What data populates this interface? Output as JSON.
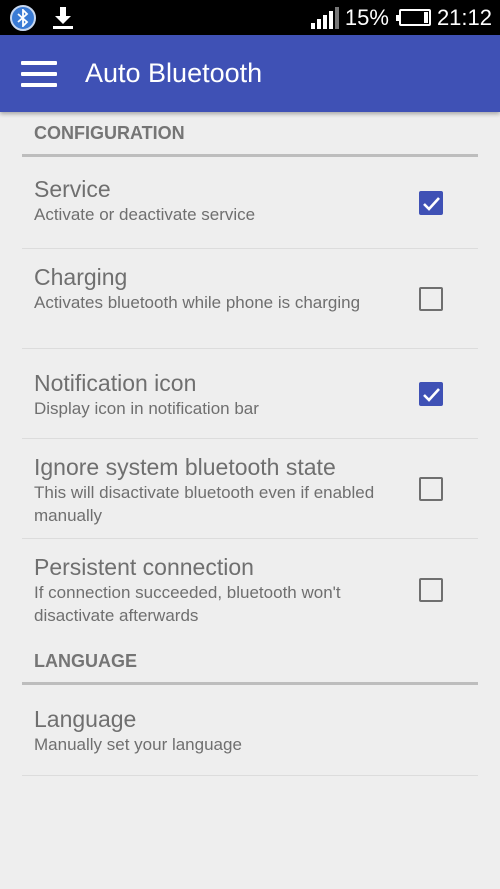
{
  "status_bar": {
    "battery": "15%",
    "battery_level": 0.15,
    "time": "21:12",
    "icons": [
      "bluetooth-icon",
      "download-icon",
      "signal-icon",
      "battery-icon"
    ]
  },
  "toolbar": {
    "title": "Auto Bluetooth",
    "color": "#3f51b5"
  },
  "sections": {
    "configuration": {
      "header": "CONFIGURATION",
      "items": [
        {
          "title": "Service",
          "summary": "Activate or deactivate service",
          "checked": true
        },
        {
          "title": "Charging",
          "summary": "Activates bluetooth while phone is charging",
          "checked": false
        },
        {
          "title": "Notification icon",
          "summary": "Display icon in notification bar",
          "checked": true
        },
        {
          "title": "Ignore system bluetooth state",
          "summary": "This will disactivate bluetooth even if enabled manually",
          "checked": false
        },
        {
          "title": "Persistent connection",
          "summary": "If connection succeeded, bluetooth won't disactivate afterwards",
          "checked": false
        }
      ]
    },
    "language": {
      "header": "LANGUAGE",
      "items": [
        {
          "title": "Language",
          "summary": "Manually set your language"
        }
      ]
    }
  }
}
